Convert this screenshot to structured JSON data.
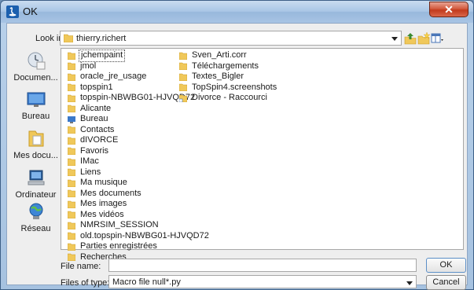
{
  "window": {
    "title": "OK",
    "close_glyph": "✕"
  },
  "lookin": {
    "label": "Look in:",
    "value": "thierry.richert"
  },
  "toolbar": {
    "up_icon": "up-folder-icon",
    "new_folder_icon": "new-folder-icon",
    "view_icon": "view-menu-icon"
  },
  "places": [
    {
      "label": "Documen...",
      "icon": "recent-documents-icon"
    },
    {
      "label": "Bureau",
      "icon": "desktop-icon"
    },
    {
      "label": "Mes docu...",
      "icon": "my-documents-icon"
    },
    {
      "label": "Ordinateur",
      "icon": "computer-icon"
    },
    {
      "label": "Réseau",
      "icon": "network-icon"
    }
  ],
  "files_col1": [
    {
      "name": "jchempaint",
      "selected": true
    },
    {
      "name": "jmol"
    },
    {
      "name": "oracle_jre_usage"
    },
    {
      "name": "topspin1"
    },
    {
      "name": "topspin-NBWBG01-HJVQD72"
    },
    {
      "name": "Alicante"
    },
    {
      "name": "Bureau",
      "icon": "desktop"
    },
    {
      "name": "Contacts"
    },
    {
      "name": "dIVORCE"
    },
    {
      "name": "Favoris"
    },
    {
      "name": "IMac"
    },
    {
      "name": "Liens"
    },
    {
      "name": "Ma musique"
    },
    {
      "name": "Mes documents"
    },
    {
      "name": "Mes images"
    },
    {
      "name": "Mes vidéos"
    },
    {
      "name": "NMRSIM_SESSION"
    },
    {
      "name": "old.topspin-NBWBG01-HJVQD72"
    },
    {
      "name": "Parties enregistrées"
    },
    {
      "name": "Recherches"
    }
  ],
  "files_col2": [
    {
      "name": "Sven_Arti.corr"
    },
    {
      "name": "Téléchargements"
    },
    {
      "name": "Textes_Bigler"
    },
    {
      "name": "TopSpin4.screenshots"
    },
    {
      "name": "Divorce - Raccourci",
      "icon": "shortcut"
    }
  ],
  "filename": {
    "label": "File name:",
    "value": ""
  },
  "filetype": {
    "label": "Files of type:",
    "value": "Macro file null*.py"
  },
  "buttons": {
    "ok": "OK",
    "cancel": "Cancel"
  }
}
